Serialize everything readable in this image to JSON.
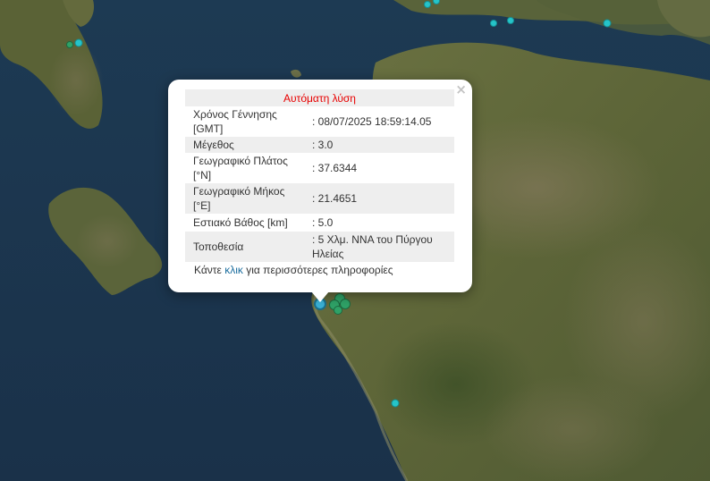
{
  "popup": {
    "title": "Αυτόματη λύση",
    "close": "×",
    "rows": [
      {
        "label": "Χρόνος Γέννησης [GMT]",
        "value": ": 08/07/2025 18:59:14.05"
      },
      {
        "label": "Μέγεθος",
        "value": ": 3.0"
      },
      {
        "label": "Γεωγραφικό Πλάτος [°N]",
        "value": ": 37.6344"
      },
      {
        "label": "Γεωγραφικό Μήκος [°E]",
        "value": ": 21.4651"
      },
      {
        "label": "Εστιακό Βάθος [km]",
        "value": ": 5.0"
      },
      {
        "label": "Τοποθεσία",
        "value": ": 5 Χλμ. ΝΝΑ του Πύργου Ηλείας"
      }
    ],
    "more_prefix": "Κάντε ",
    "more_link": "κλικ",
    "more_suffix": " για περισσότερες πληροφορίες"
  },
  "colors": {
    "sea": "#1b3650",
    "land": "#5f6a3c",
    "marker_cyan": "#25c4c9",
    "marker_green": "#2fa267",
    "title_red": "#e80000",
    "link_blue": "#1b6d9e"
  }
}
